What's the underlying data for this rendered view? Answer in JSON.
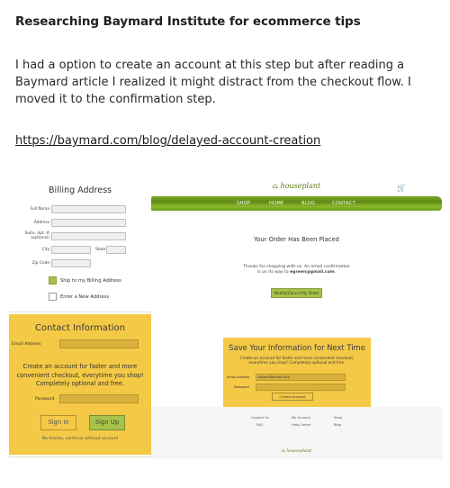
{
  "post": {
    "heading": "Researching Baymard Institute for ecommerce tips",
    "paragraph": "I had a option to create an account at this step but after reading a Baymard article I realized it might distract from the checkout flow. I moved it to the confirmation step.",
    "link": "https://baymard.com/blog/delayed-account-creation"
  },
  "billing": {
    "title": "Billing Address",
    "fields": {
      "full_name": "Full Name",
      "address": "Address",
      "suite_line1": "Suite, Apt. #",
      "suite_line2": "(optional)",
      "city": "City",
      "state": "State",
      "zip": "Zip Code"
    },
    "options": {
      "ship_to_billing": "Ship to my Billing Address",
      "new_address": "Enter a New Address"
    }
  },
  "contact": {
    "title": "Contact Information",
    "email_label": "Email Address",
    "message": "Create an account for faster and more convenient checkout, everytime you shop! Completely optional and free.",
    "password_label": "Password",
    "sign_in": "Sign In",
    "sign_up": "Sign Up",
    "skip": "No thanks, continue without account"
  },
  "site": {
    "logo": "houseplant",
    "nav": [
      "SHOP",
      "HOME",
      "BLOG",
      "CONTACT"
    ],
    "order_title": "Your Order Has Been Placed",
    "order_text_1": "Thanks for shopping with us. An email confirmation",
    "order_text_2": "is on its way to ",
    "order_email": "egreen@gmail.com",
    "order_text_end": ".",
    "modify_button": "Modify/Cancel My Order",
    "save": {
      "title": "Save Your Information for Next Time",
      "text": "Create an account for faster and more convenient checkout, everytime you shop! Completely optional and free.",
      "email_label": "Email Address",
      "email_value": "egreen@gmail.com",
      "password_label": "Password",
      "create_button": "Create Account"
    },
    "footer": {
      "col1": [
        "Contact Us",
        "FAQ"
      ],
      "col2": [
        "My Account",
        "Help Center"
      ],
      "col3": [
        "Shop",
        "Blog"
      ],
      "logo": "houseplant"
    }
  },
  "colors": {
    "yellow": "#f3c946",
    "green": "#a7c24a",
    "brand_green": "#5e7b1d"
  }
}
